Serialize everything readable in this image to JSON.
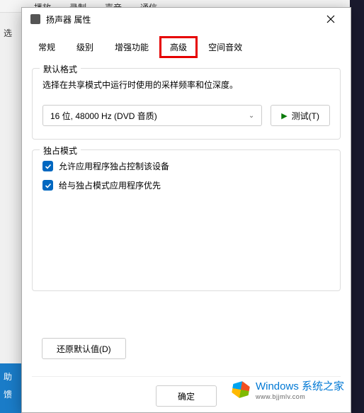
{
  "bg_tabs": [
    "播放",
    "录制",
    "声音",
    "通信"
  ],
  "bg_left_label": "选",
  "bg_bottom": [
    "助",
    "馈"
  ],
  "dialog": {
    "title": "扬声器 属性"
  },
  "tabs": {
    "general": "常规",
    "levels": "级别",
    "enhance": "增强功能",
    "advanced": "高级",
    "spatial": "空间音效"
  },
  "default_format": {
    "legend": "默认格式",
    "desc": "选择在共享模式中运行时使用的采样频率和位深度。",
    "selected": "16 位, 48000 Hz (DVD 音质)",
    "test_label": "测试(T)"
  },
  "exclusive": {
    "legend": "独占模式",
    "allow_control": "允许应用程序独占控制该设备",
    "priority": "给与独占模式应用程序优先"
  },
  "restore_label": "还原默认值(D)",
  "ok_label": "确定",
  "watermark": {
    "main": "Windows 系统之家",
    "sub": "www.bjjmlv.com"
  }
}
